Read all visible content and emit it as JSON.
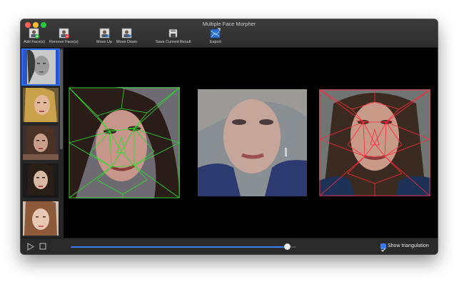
{
  "window": {
    "title": "Multiple Face Morpher"
  },
  "toolbar": {
    "add_label": "Add Face(s)",
    "remove_label": "Remove Face(s)",
    "move_up_label": "Move Up",
    "move_down_label": "Move Down",
    "save_label": "Save Current Result",
    "export_label": "Export"
  },
  "sidebar": {
    "thumbnails": [
      "face-1",
      "face-2",
      "face-3",
      "face-4",
      "face-5"
    ],
    "selected_index": 0
  },
  "playback": {
    "progress": 0.96
  },
  "options": {
    "show_triangulation_label": "Show triangulation",
    "show_triangulation_checked": true
  },
  "colors": {
    "accent": "#3b7cf7",
    "triangulation_left": "#28e028",
    "triangulation_right": "#ff2a3c"
  }
}
